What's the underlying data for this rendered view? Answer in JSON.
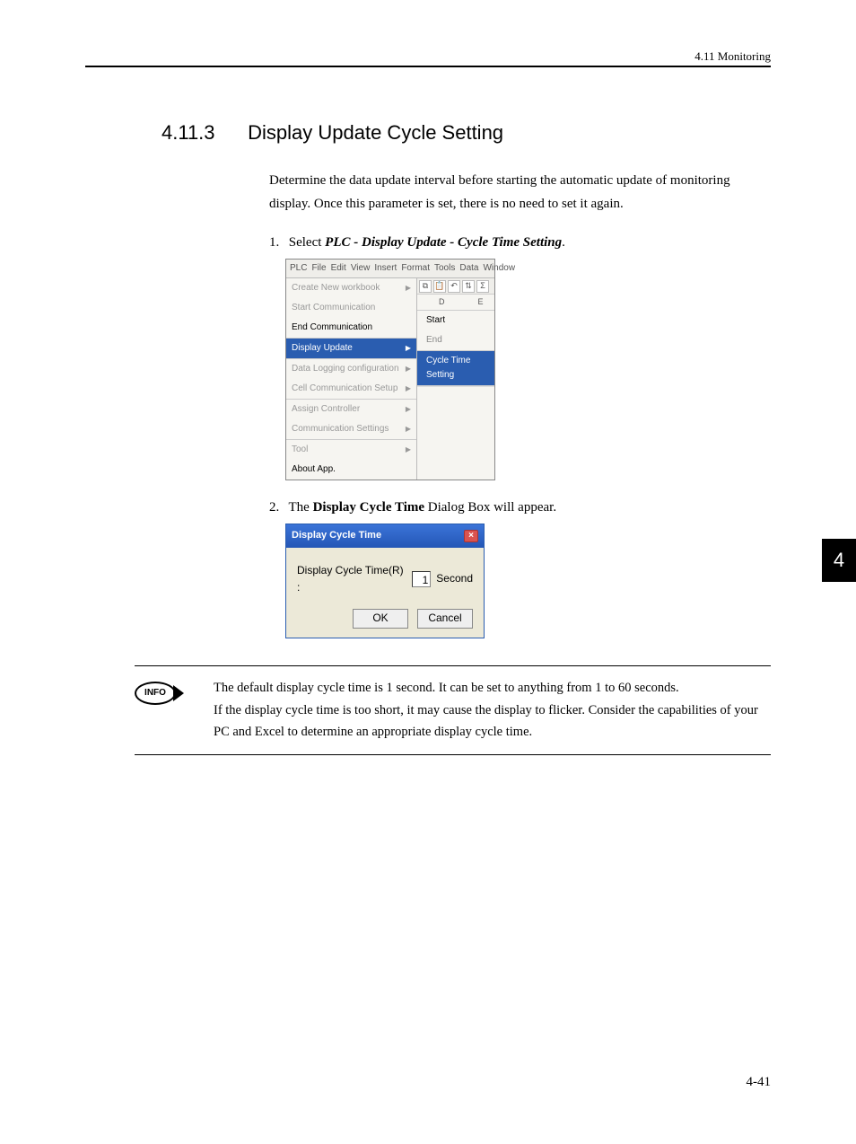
{
  "header": {
    "right": "4.11  Monitoring"
  },
  "section": {
    "number": "4.11.3",
    "title": "Display Update Cycle Setting"
  },
  "intro": "Determine the data update interval before starting the automatic update of monitoring display. Once this parameter is set, there is no need to set it again.",
  "steps": {
    "s1": {
      "num": "1.",
      "lead": "Select ",
      "bold": "PLC - Display Update - Cycle Time Setting",
      "tail": "."
    },
    "s2": {
      "num": "2.",
      "lead": "The ",
      "bold": "Display Cycle Time",
      "tail": " Dialog Box will appear."
    }
  },
  "menu": {
    "items_bar": [
      "PLC",
      "File",
      "Edit",
      "View",
      "Insert",
      "Format",
      "Tools",
      "Data",
      "Window"
    ],
    "main": {
      "g1": [
        {
          "label": "Create New workbook",
          "enabled": false,
          "arrow": true
        },
        {
          "label": "Start Communication",
          "enabled": false,
          "arrow": false
        },
        {
          "label": "End Communication",
          "enabled": true,
          "arrow": false
        }
      ],
      "sel": {
        "label": "Display Update",
        "arrow": true
      },
      "g2": [
        {
          "label": "Data Logging configuration",
          "enabled": false,
          "arrow": true
        },
        {
          "label": "Cell Communication Setup",
          "enabled": false,
          "arrow": true
        }
      ],
      "g3": [
        {
          "label": "Assign Controller",
          "enabled": false,
          "arrow": true
        },
        {
          "label": "Communication Settings",
          "enabled": false,
          "arrow": true
        }
      ],
      "g4": [
        {
          "label": "Tool",
          "enabled": false,
          "arrow": true
        },
        {
          "label": "About App.",
          "enabled": true,
          "arrow": false
        }
      ]
    },
    "sub_head_d": "D",
    "sub_head_e": "E",
    "sub": [
      {
        "label": "Start",
        "enabled": true
      },
      {
        "label": "End",
        "enabled": false
      }
    ],
    "sub_sel": "Cycle Time Setting"
  },
  "dialog": {
    "title": "Display Cycle Time",
    "label": "Display Cycle Time(R) :",
    "value": "1",
    "unit": "Second",
    "ok": "OK",
    "cancel": "Cancel"
  },
  "info": {
    "badge": "INFO",
    "l1": "The default display cycle time is 1 second. It can be set to anything from 1 to 60 seconds.",
    "l2": "If the display cycle time is too short, it may cause the display to flicker. Consider the capabilities of your PC and Excel to determine an appropriate display cycle time."
  },
  "tab": "4",
  "page": "4-41"
}
